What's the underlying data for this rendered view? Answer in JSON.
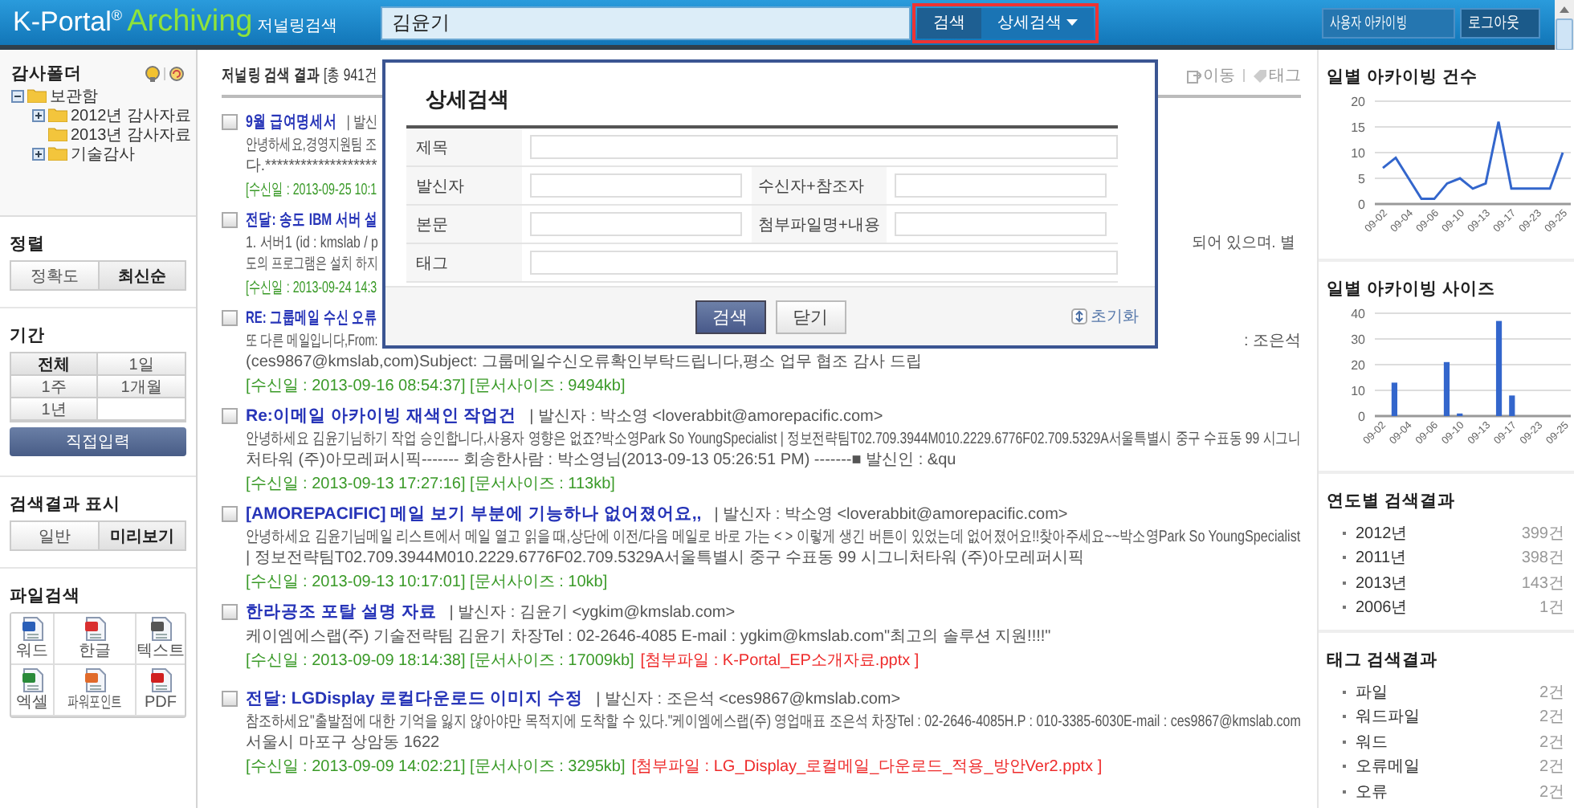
{
  "header": {
    "logo": {
      "brand": "K-Portal",
      "mark": "®",
      "product": "Archiving",
      "subtitle": "저널링검색"
    },
    "search": {
      "value": "김윤기"
    },
    "search_button": "검색",
    "advanced_button": "상세검색",
    "user_buttons": [
      "사용자 아카이빙",
      "로그아웃"
    ]
  },
  "sidebar": {
    "folders": {
      "title": "감사폴더",
      "items": [
        {
          "label": "보관함",
          "expanded": true,
          "children": [
            {
              "label": "2012년 감사자료",
              "expanded": false
            },
            {
              "label": "2013년 감사자료"
            },
            {
              "label": "기술감사",
              "expanded": false
            }
          ]
        }
      ]
    },
    "sort": {
      "title": "정렬",
      "options": [
        {
          "label": "정확도",
          "selected": false
        },
        {
          "label": "최신순",
          "selected": true
        }
      ]
    },
    "period": {
      "title": "기간",
      "options": [
        {
          "label": "전체",
          "selected": true
        },
        {
          "label": "1일",
          "selected": false
        },
        {
          "label": "1주",
          "selected": false
        },
        {
          "label": "1개월",
          "selected": false
        },
        {
          "label": "1년",
          "selected": false
        }
      ],
      "custom_button": "직접입력"
    },
    "display": {
      "title": "검색결과 표시",
      "options": [
        {
          "label": "일반",
          "selected": false
        },
        {
          "label": "미리보기",
          "selected": true
        }
      ]
    },
    "file_search": {
      "title": "파일검색",
      "types": [
        {
          "kind": "word",
          "label": "워드"
        },
        {
          "kind": "hwp",
          "label": "한글"
        },
        {
          "kind": "text",
          "label": "텍스트"
        },
        {
          "kind": "excel",
          "label": "엑셀"
        },
        {
          "kind": "powerpoint",
          "label": "파워포인트"
        },
        {
          "kind": "pdf",
          "label": "PDF"
        }
      ]
    }
  },
  "results": {
    "heading": "**저널링 검색 결과** [총 941건",
    "actions": [
      {
        "kind": "move",
        "label": "이동"
      },
      {
        "kind": "tag",
        "label": "태그"
      }
    ],
    "items": [
      {
        "checked": false,
        "title": "9월 급여명세서",
        "sender": "| 발신",
        "lines": [
          {
            "text": "안녕하세요,경영지원팀 조"
          },
          {
            "text": "다.*******************"
          }
        ],
        "meta": [
          {
            "kind": "info",
            "text": "[수신일 : 2013-09-25 10:1"
          }
        ]
      },
      {
        "checked": false,
        "title": "전달: 송도 IBM 서버 설",
        "lines": [
          {
            "text": "1. 서버1 (id : kmslab / p",
            "tail": "되어 있으며. 별"
          },
          {
            "text": "도의 프로그램은 설치 하지"
          }
        ],
        "meta": [
          {
            "kind": "info",
            "text": "[수신일 : 2013-09-24 14:3"
          }
        ]
      },
      {
        "checked": false,
        "title": "RE: 그룹메일 수신 오류",
        "lines": [
          {
            "text": "또 다른 메일입니다,From:",
            "tail": ": 조은석"
          },
          {
            "text": "(ces9867@kmslab,com)Subject: 그룹메일수신오류확인부탁드립니다,평소 업무 협조 감사 드립"
          }
        ],
        "meta": [
          {
            "kind": "info",
            "text": "[수신일 : 2013-09-16 08:54:37] [문서사이즈 : 9494kb]"
          }
        ]
      },
      {
        "checked": false,
        "title": "Re:이메일 아카이빙 재색인 작업건",
        "sender": "| 발신자 : 박소영 <loverabbit@amorepacific.com>",
        "lines": [
          {
            "text": "안녕하세요 김윤기님하기 작업 승인합니다,사용자 영향은 없죠?박소영Park So YoungSpecialist | 정보전략팀T02.709.3944M010.2229.6776F02.709.5329A서울특별시 중구 수표동 99 시그니"
          },
          {
            "text": "처타워 (주)아모레퍼시픽------- 회송한사람 : 박소영님(2013-09-13 05:26:51 PM) -------■ 발신인 : &qu"
          }
        ],
        "meta": [
          {
            "kind": "info",
            "text": "[수신일 : 2013-09-13 17:27:16] [문서사이즈 : 113kb]"
          }
        ]
      },
      {
        "checked": false,
        "title": "[AMOREPACIFIC] 메일 보기 부분에 기능하나 없어졌어요,,",
        "sender": "| 발신자 : 박소영 <loverabbit@amorepacific.com>",
        "lines": [
          {
            "text": "안녕하세요 김윤기님메일 리스트에서 메일 열고 읽을 때,상단에 이전/다음 메일로 바로 가는 < > 이렇게 생긴 버튼이 있었는데 없어졌어요!!찾아주세요~~박소영Park So YoungSpecialist"
          },
          {
            "text": "| 정보전략팀T02.709.3944M010.2229.6776F02.709.5329A서울특별시 중구 수표동 99 시그니처타워 (주)아모레퍼시픽"
          }
        ],
        "meta": [
          {
            "kind": "info",
            "text": "[수신일 : 2013-09-13 10:17:01] [문서사이즈 : 10kb]"
          }
        ]
      },
      {
        "checked": false,
        "title": "한라공조 포탈 설명 자료",
        "sender": "| 발신자 : 김윤기 <ygkim@kmslab.com>",
        "lines": [
          {
            "text": "케이엠에스랩(주) 기술전략팀 김윤기 차장Tel : 02-2646-4085 E-mail : ygkim@kmslab.com\"최고의 솔루션 지원!!!!\""
          }
        ],
        "meta": [
          {
            "kind": "info",
            "text": "[수신일 : 2013-09-09 18:14:38] [문서사이즈 : 17009kb]"
          },
          {
            "kind": "attachment",
            "text": "[첨부파일 : K-Portal_EP소개자료.pptx ]"
          }
        ]
      },
      {
        "checked": false,
        "title": "전달: LGDisplay 로컬다운로드 이미지 수정",
        "sender": "| 발신자 : 조은석 <ces9867@kmslab.com>",
        "lines": [
          {
            "text": "참조하세요\"출발점에 대한 기억을 잃지 않아야만 목적지에 도착할 수 있다.\"케이엠에스랩(주) 영업매표 조은석 차장Tel : 02-2646-4085H.P : 010-3385-6030E-mail : ces9867@kmslab.com"
          },
          {
            "text": "서울시 마포구 상암동 1622"
          }
        ],
        "meta": [
          {
            "kind": "info",
            "text": "[수신일 : 2013-09-09 14:02:21] [문서사이즈 : 3295kb]"
          },
          {
            "kind": "attachment",
            "text": "[첨부파일 : LG_Display_로컬메일_다운로드_적용_방안Ver2.pptx ]"
          }
        ]
      }
    ]
  },
  "advanced_search": {
    "title": "상세검색",
    "rows": [
      [
        {
          "label": "제목"
        }
      ],
      [
        {
          "label": "발신자"
        },
        {
          "label": "수신자+참조자"
        }
      ],
      [
        {
          "label": "본문"
        },
        {
          "label": "첨부파일명+내용"
        }
      ],
      [
        {
          "label": "태그"
        }
      ]
    ],
    "buttons": [
      {
        "kind": "primary",
        "label": "검색"
      },
      {
        "kind": "secondary",
        "label": "닫기"
      }
    ],
    "reset": "초기화"
  },
  "stats": {
    "daily_count": {
      "title": "일별 아카이빙 건수",
      "chart_data": {
        "type": "line",
        "categories": [
          "09-02",
          null,
          "09-04",
          null,
          "09-06",
          null,
          "09-10",
          null,
          "09-13",
          null,
          "09-17",
          null,
          "09-23",
          null,
          "09-25"
        ],
        "ylim": [
          0,
          20
        ],
        "yticks": [
          0,
          5,
          10,
          15,
          20
        ],
        "grid": true,
        "series": [
          {
            "color": "#3366cc",
            "values": [
              7,
              9,
              5,
              1,
              1,
              4,
              5,
              3,
              4,
              16,
              3,
              3,
              3,
              3,
              10
            ]
          }
        ]
      }
    },
    "daily_size": {
      "title": "일별 아카이빙 사이즈",
      "chart_data": {
        "type": "bar",
        "categories": [
          "09-02",
          null,
          "09-04",
          null,
          "09-06",
          null,
          "09-10",
          null,
          "09-13",
          null,
          "09-17",
          null,
          "09-23",
          null,
          "09-25"
        ],
        "ylim": [
          0,
          40
        ],
        "yticks": [
          0,
          10,
          20,
          30,
          40
        ],
        "grid": true,
        "series": [
          {
            "color": "#3366cc",
            "values": [
              0,
              13,
              0,
              0,
              0,
              21,
              1,
              0,
              0,
              37,
              8,
              0,
              0,
              0,
              0
            ]
          }
        ]
      }
    },
    "by_year": {
      "title": "연도별 검색결과",
      "items": [
        {
          "label": "2012년",
          "count": "399건"
        },
        {
          "label": "2011년",
          "count": "398건"
        },
        {
          "label": "2013년",
          "count": "143건"
        },
        {
          "label": "2006년",
          "count": "1건"
        }
      ]
    },
    "by_tag": {
      "title": "태그 검색결과",
      "items": [
        {
          "label": "파일",
          "count": "2건"
        },
        {
          "label": "워드파일",
          "count": "2건"
        },
        {
          "label": "워드",
          "count": "2건"
        },
        {
          "label": "오류메일",
          "count": "2건"
        },
        {
          "label": "오류",
          "count": "2건"
        }
      ]
    }
  }
}
